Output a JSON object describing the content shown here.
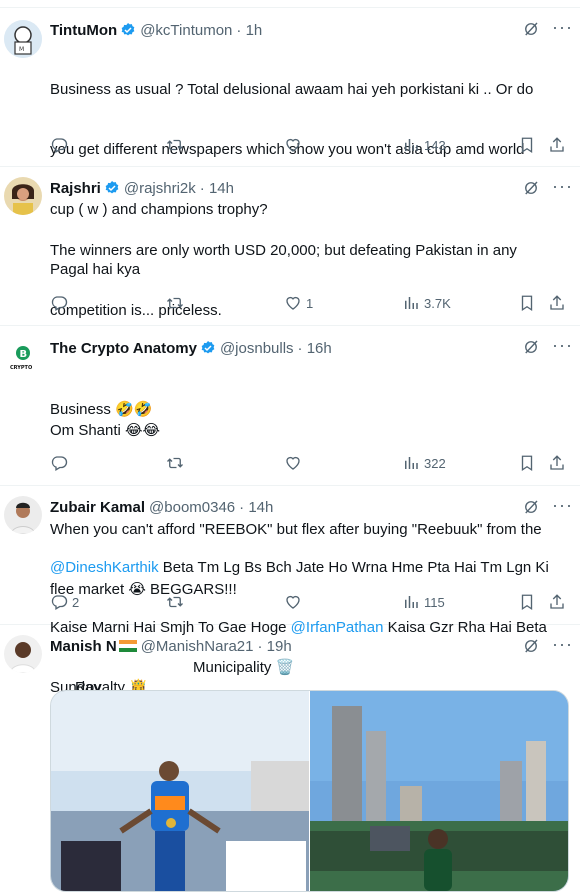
{
  "tweets": [
    {
      "name": "TintuMon",
      "handle": "@kcTintumon",
      "time": "· 1h",
      "verified": true,
      "lines": [
        "Business as usual ? Total delusional awaam hai yeh porkistani ki .. Or do",
        "you get different newspapers which show you won't asia cup amd world",
        "cup ( w ) and champions trophy?",
        "Pagal hai kya"
      ],
      "replies": "",
      "retweets": "",
      "likes": "",
      "views": "143"
    },
    {
      "name": "Rajshri",
      "handle": "@rajshri2k",
      "time": "· 14h",
      "verified": true,
      "lines": [
        "The winners are only worth USD 20,000; but defeating Pakistan in any",
        "competition is... priceless.",
        "",
        "Om Shanti 😂😂"
      ],
      "replies": "",
      "retweets": "",
      "likes": "1",
      "views": "3.7K"
    },
    {
      "name": "The Crypto Anatomy",
      "handle": "@josnbulls",
      "time": "· 16h",
      "verified": true,
      "lines": [
        "Business 🤣🤣",
        "",
        "When you can't afford \"REEBOK\" but flex after buying \"Reebuuk\" from the",
        "flee market 😭 BEGGARS!!!"
      ],
      "replies": "",
      "retweets": "",
      "likes": "",
      "views": "322"
    },
    {
      "name": "Zubair Kamal",
      "handle": "@boom0346",
      "time": "· 14h",
      "verified": false,
      "line1_mention": "@DineshKarthik",
      "line1_rest": " Beta Tm Lg Bs Bch Jate Ho Wrna Hme Pta Hai Tm Lgn Ki",
      "line2_pre": "Kaise Marni Hai Smjh To Gae Hoge ",
      "line2_mention": "@IrfanPathan",
      "line2_rest": " Kaisa Gzr Rha Hai Beta",
      "line3": "Sunday",
      "replies": "2",
      "retweets": "",
      "likes": "",
      "views": "115"
    },
    {
      "name": "Manish N",
      "handle": "@ManishNara21",
      "time": "· 19h",
      "verified": false,
      "text_left": "Royalty 🤴",
      "text_right": "Municipality 🗑️"
    }
  ],
  "colors": {
    "accent": "#1d9bf0",
    "muted": "#536471",
    "text": "#0f1419",
    "border": "#eff3f4"
  },
  "icons": [
    "reply-icon",
    "retweet-icon",
    "like-icon",
    "views-icon",
    "bookmark-icon",
    "share-icon",
    "grok-icon",
    "verified-icon"
  ]
}
